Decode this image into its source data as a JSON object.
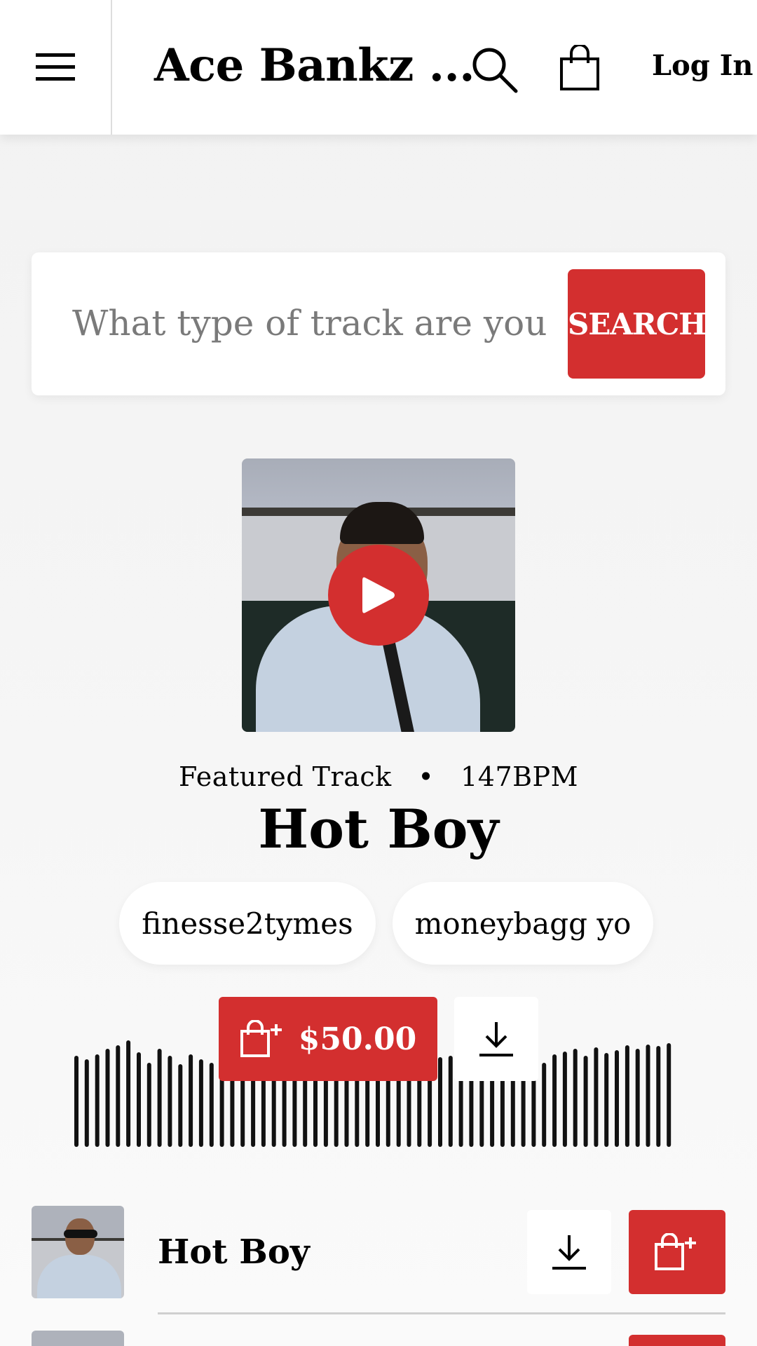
{
  "header": {
    "title": "Ace Bankz ...",
    "login_label": "Log In",
    "icons": [
      "hamburger-menu-icon",
      "search-icon",
      "shopping-bag-icon"
    ]
  },
  "search": {
    "placeholder": "What type of track are you looking for?",
    "button_label": "SEARCH"
  },
  "featured": {
    "label": "Featured Track",
    "bpm": "147BPM",
    "title": "Hot Boy",
    "tags": [
      "finesse2tymes",
      "moneybagg yo"
    ],
    "price": "$50.00"
  },
  "tracks": [
    {
      "name": "Hot Boy"
    }
  ],
  "colors": {
    "accent": "#d32f2f",
    "background": "#f4f4f4",
    "card": "#ffffff"
  }
}
